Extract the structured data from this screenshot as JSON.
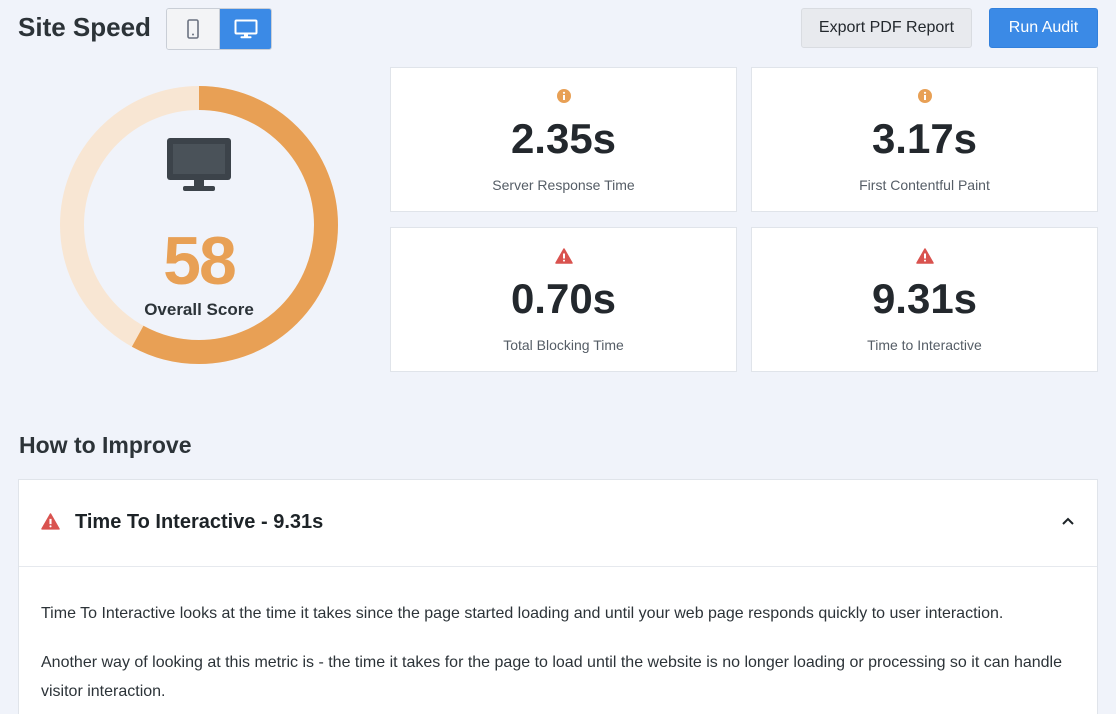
{
  "header": {
    "title": "Site Speed",
    "device_toggle": [
      {
        "icon": "mobile-icon",
        "active": false
      },
      {
        "icon": "desktop-icon",
        "active": true
      }
    ],
    "export_label": "Export PDF Report",
    "run_label": "Run Audit"
  },
  "score": {
    "value": "58",
    "fraction": 0.58,
    "label": "Overall Score",
    "icon": "desktop-monitor-icon",
    "color": "#e8a055",
    "track_color": "#f8e6d3"
  },
  "metrics": [
    {
      "value": "2.35s",
      "label": "Server Response Time",
      "icon": "info-icon",
      "status": "warning",
      "icon_color": "#e8a055"
    },
    {
      "value": "3.17s",
      "label": "First Contentful Paint",
      "icon": "info-icon",
      "status": "warning",
      "icon_color": "#e8a055"
    },
    {
      "value": "0.70s",
      "label": "Total Blocking Time",
      "icon": "alert-triangle-icon",
      "status": "error",
      "icon_color": "#d9534f"
    },
    {
      "value": "9.31s",
      "label": "Time to Interactive",
      "icon": "alert-triangle-icon",
      "status": "error",
      "icon_color": "#d9534f"
    }
  ],
  "improve": {
    "title": "How to Improve",
    "panel": {
      "title": "Time To Interactive - 9.31s",
      "icon": "alert-triangle-icon",
      "expanded": true,
      "paragraphs": [
        "Time To Interactive looks at the time it takes since the page started loading and until your web page responds quickly to user interaction.",
        "Another way of looking at this metric is - the time it takes for the page to load until the website is no longer loading or processing so it can handle visitor interaction."
      ]
    }
  },
  "colors": {
    "background": "#f0f3fa",
    "accent": "#3b8ae6",
    "warning": "#e8a055",
    "error": "#d9534f"
  }
}
